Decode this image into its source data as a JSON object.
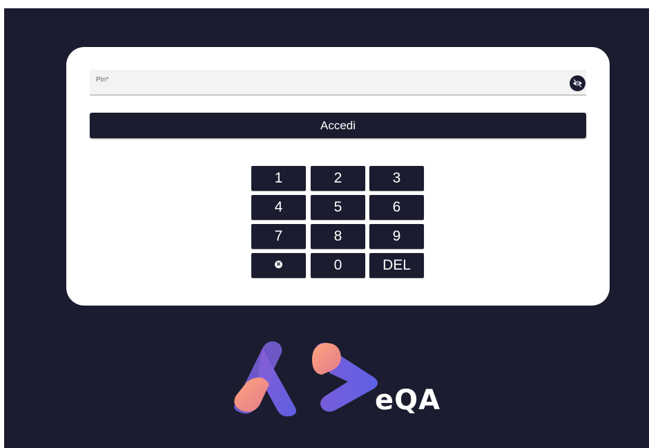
{
  "login": {
    "pin_label": "Pin*",
    "pin_value": "",
    "toggle_icon": "eye-off-icon",
    "submit_label": "Accedi"
  },
  "keypad": {
    "keys": [
      "1",
      "2",
      "3",
      "4",
      "5",
      "6",
      "7",
      "8",
      "9",
      "",
      "0",
      "DEL"
    ],
    "clear_icon": "clear-circle-icon"
  },
  "brand": {
    "logo_text": "eQA"
  },
  "colors": {
    "background": "#1b1c2f",
    "card": "#ffffff",
    "accent_start": "#ff9a7b",
    "accent_end": "#6b5cf0"
  }
}
